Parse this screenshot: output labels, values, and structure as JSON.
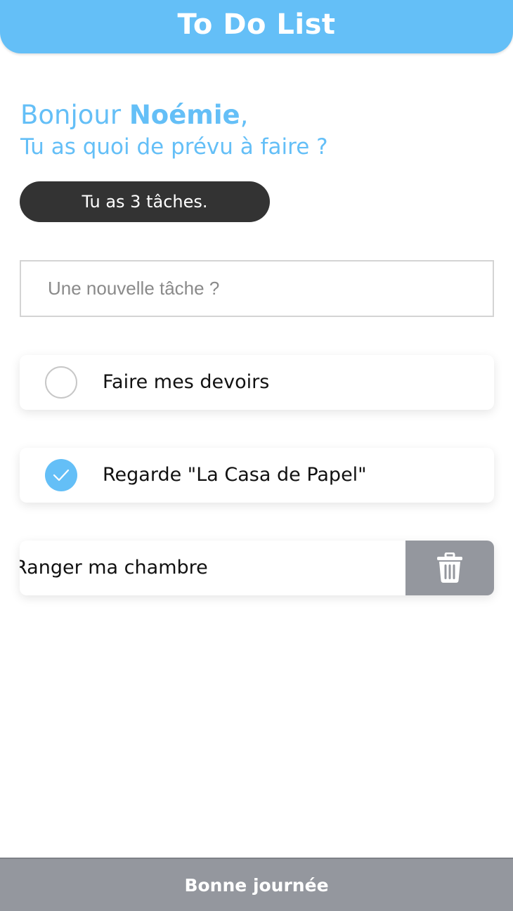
{
  "header": {
    "title": "To Do List"
  },
  "greeting": {
    "hello": "Bonjour ",
    "name": "Noémie",
    "comma": ",",
    "question": "Tu as quoi de prévu à faire ?"
  },
  "summary": {
    "count_text": "Tu as 3 tâches."
  },
  "new_task": {
    "placeholder": "Une nouvelle tâche ?",
    "value": ""
  },
  "tasks": [
    {
      "label": "Faire mes devoirs",
      "completed": false
    },
    {
      "label": "Regarde \"La Casa de Papel\"",
      "completed": true
    },
    {
      "label": "Ranger ma chambre",
      "completed": false,
      "swiped_reveal": "delete"
    }
  ],
  "icons": {
    "check": "check-icon",
    "delete": "trash-icon"
  },
  "colors": {
    "accent": "#64bff7",
    "dark_pill": "#333333",
    "delete_bg": "#94979e",
    "footer_bg": "#94979e"
  },
  "footer": {
    "text": "Bonne journée"
  }
}
